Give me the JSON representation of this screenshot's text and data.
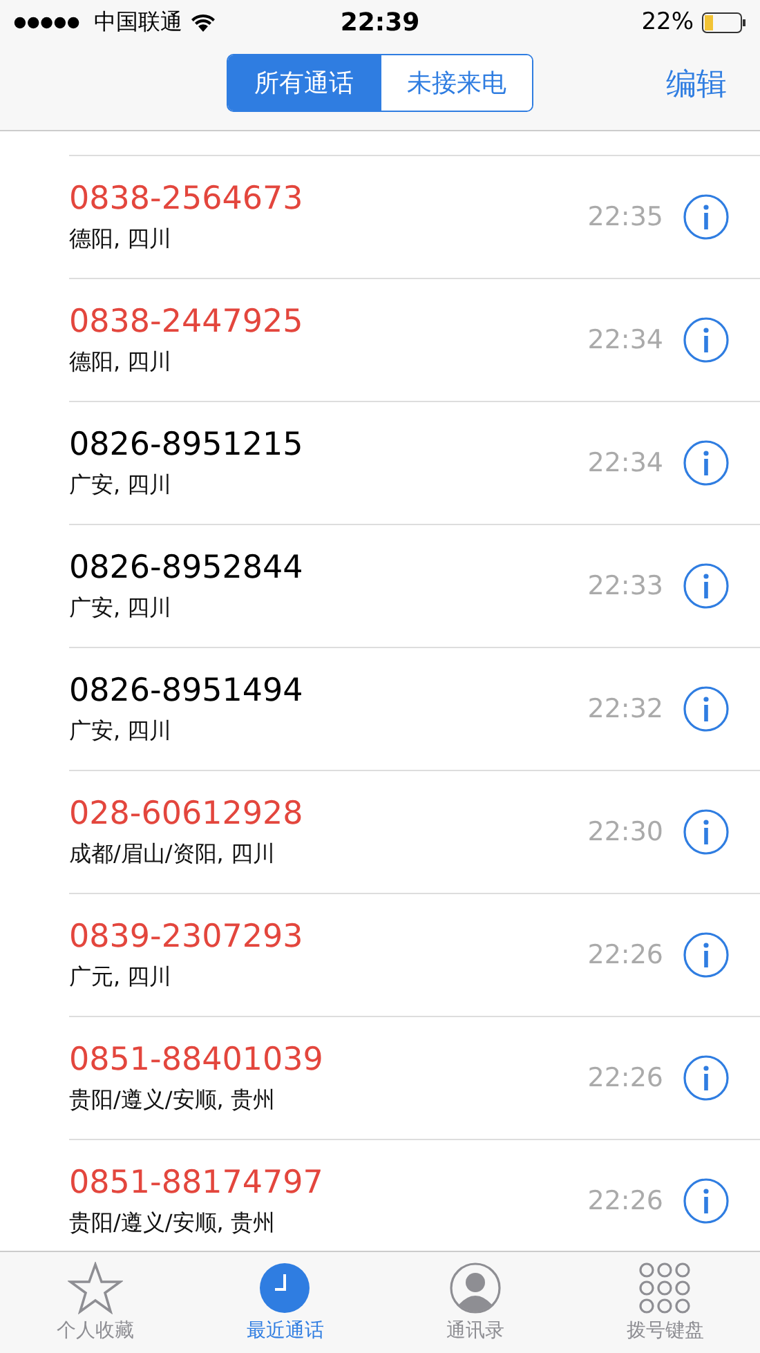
{
  "status_bar": {
    "carrier": "中国联通",
    "time": "22:39",
    "battery": "22%"
  },
  "segments": [
    {
      "label": "所有通话",
      "selected": true
    },
    {
      "label": "未接来电",
      "selected": false
    }
  ],
  "edit_button": "编辑",
  "calls": [
    {
      "number": "0838-2564673",
      "location": "德阳, 四川",
      "time": "22:35",
      "missed": true
    },
    {
      "number": "0838-2447925",
      "location": "德阳, 四川",
      "time": "22:34",
      "missed": true
    },
    {
      "number": "0826-8951215",
      "location": "广安, 四川",
      "time": "22:34",
      "missed": false
    },
    {
      "number": "0826-8952844",
      "location": "广安, 四川",
      "time": "22:33",
      "missed": false
    },
    {
      "number": "0826-8951494",
      "location": "广安, 四川",
      "time": "22:32",
      "missed": false
    },
    {
      "number": "028-60612928",
      "location": "成都/眉山/资阳, 四川",
      "time": "22:30",
      "missed": true
    },
    {
      "number": "0839-2307293",
      "location": "广元, 四川",
      "time": "22:26",
      "missed": true
    },
    {
      "number": "0851-88401039",
      "location": "贵阳/遵义/安顺, 贵州",
      "time": "22:26",
      "missed": true
    },
    {
      "number": "0851-88174797",
      "location": "贵阳/遵义/安顺, 贵州",
      "time": "22:26",
      "missed": true
    }
  ],
  "tab_bar": [
    {
      "label": "个人收藏",
      "kind": "star",
      "selected": false
    },
    {
      "label": "最近通话",
      "kind": "clock",
      "selected": true
    },
    {
      "label": "通讯录",
      "kind": "contact",
      "selected": false
    },
    {
      "label": "拨号键盘",
      "kind": "keypad",
      "selected": false
    }
  ]
}
